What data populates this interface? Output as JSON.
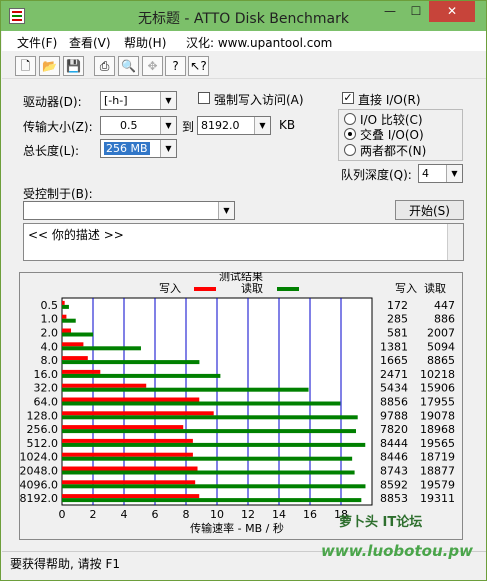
{
  "window": {
    "title": "无标题 - ATTO Disk Benchmark",
    "min": "—",
    "max": "☐",
    "close": "✕"
  },
  "menu": {
    "file": "文件(F)",
    "view": "查看(V)",
    "help": "帮助(H)",
    "site": "汉化: www.upantool.com"
  },
  "toolbar": {
    "buttons": [
      "new-doc-icon",
      "open-folder-icon",
      "save-icon",
      "print-icon",
      "print-preview-icon",
      "move-icon",
      "help-icon",
      "context-help-icon"
    ]
  },
  "settings": {
    "drive_label": "驱动器(D):",
    "drive_value": "[-h-]",
    "force_write_label": "强制写入访问(A)",
    "force_write_checked": false,
    "transfer_label": "传输大小(Z):",
    "transfer_from": "0.5",
    "transfer_to_label": "到",
    "transfer_to": "8192.0",
    "transfer_unit": "KB",
    "total_label": "总长度(L):",
    "total_value": "256 MB",
    "direct_io_label": "直接 I/O(R)",
    "direct_io_checked": true,
    "io_compare_label": "I/O 比较(C)",
    "overlap_io_label": "交叠 I/O(O)",
    "neither_label": "两者都不(N)",
    "io_mode_selected": "overlap",
    "queue_label": "队列深度(Q):",
    "queue_value": "4",
    "controlled_by_label": "受控制于(B):",
    "controlled_by_value": "",
    "start_button": "开始(S)",
    "description": "<<    你的描述     >>"
  },
  "chart_data": {
    "type": "bar",
    "title": "测试结果",
    "orientation": "horizontal",
    "categories": [
      "0.5",
      "1.0",
      "2.0",
      "4.0",
      "8.0",
      "16.0",
      "32.0",
      "64.0",
      "128.0",
      "256.0",
      "512.0",
      "1024.0",
      "2048.0",
      "4096.0",
      "8192.0"
    ],
    "series": [
      {
        "name": "写入",
        "color": "#ff0000",
        "values": [
          172,
          285,
          581,
          1381,
          1665,
          2471,
          5434,
          8856,
          9788,
          7820,
          8444,
          8446,
          8743,
          8592,
          8853
        ]
      },
      {
        "name": "读取",
        "color": "#008000",
        "values": [
          447,
          886,
          2007,
          5094,
          8865,
          10218,
          15906,
          17955,
          19078,
          18968,
          19565,
          18719,
          18877,
          19579,
          19311
        ]
      }
    ],
    "xlabel": "传输速率 - MB / 秒",
    "xlim": [
      0,
      20
    ],
    "xticks": [
      "0",
      "2",
      "4",
      "6",
      "8",
      "10",
      "12",
      "14",
      "16",
      "18"
    ],
    "grid": true,
    "grid_color": "#0000cc",
    "write_col_header": "写入",
    "read_col_header": "读取",
    "write_values": [
      "172",
      "285",
      "581",
      "1381",
      "1665",
      "2471",
      "5434",
      "8856",
      "9788",
      "7820",
      "8444",
      "8446",
      "8743",
      "8592",
      "8853"
    ],
    "read_values": [
      "447",
      "886",
      "2007",
      "5094",
      "8865",
      "10218",
      "15906",
      "17955",
      "19078",
      "18968",
      "19565",
      "18719",
      "18877",
      "19579",
      "19311"
    ]
  },
  "status": {
    "text": "要获得帮助, 请按 F1"
  },
  "watermark": {
    "logo": "萝卜头 IT论坛",
    "url": "www.luobotou.pw"
  },
  "colors": {
    "titlebar": "#7cc06a",
    "close": "#c7443a",
    "write": "#ff0000",
    "read": "#008000"
  }
}
